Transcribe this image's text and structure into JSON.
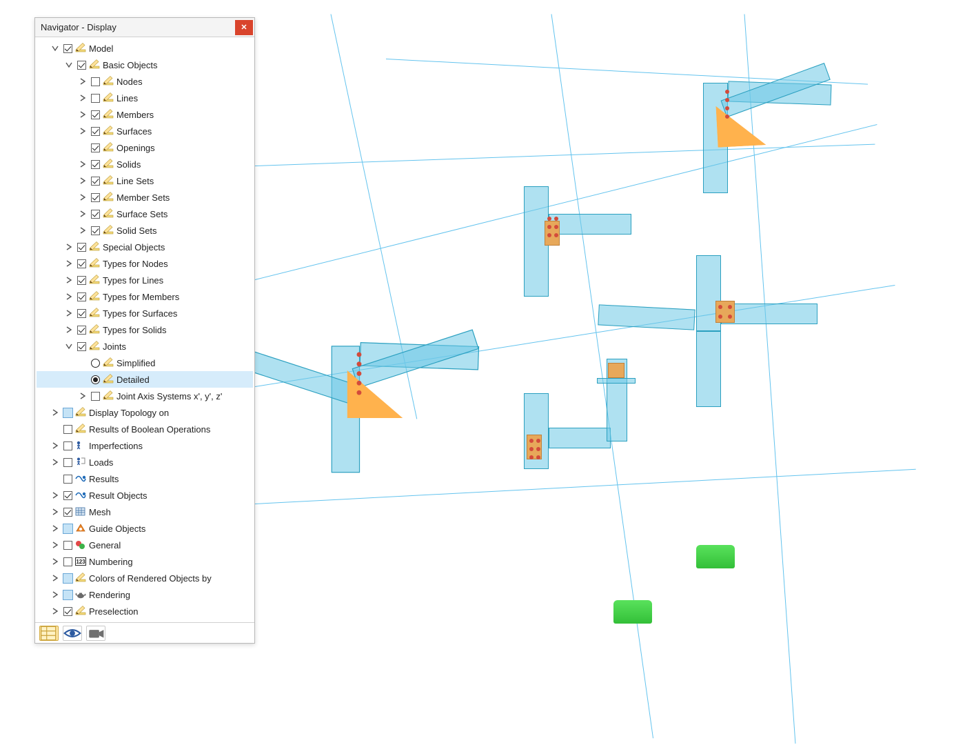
{
  "panel": {
    "title": "Navigator - Display",
    "tree": [
      {
        "indent": 0,
        "expander": "down",
        "check": "square-on",
        "icon": "pencil",
        "label": "Model"
      },
      {
        "indent": 1,
        "expander": "down",
        "check": "square-on",
        "icon": "pencil",
        "label": "Basic Objects"
      },
      {
        "indent": 2,
        "expander": "right",
        "check": "square-off",
        "icon": "pencil",
        "label": "Nodes"
      },
      {
        "indent": 2,
        "expander": "right",
        "check": "square-off",
        "icon": "pencil",
        "label": "Lines"
      },
      {
        "indent": 2,
        "expander": "right",
        "check": "square-on",
        "icon": "pencil",
        "label": "Members"
      },
      {
        "indent": 2,
        "expander": "right",
        "check": "square-on",
        "icon": "pencil",
        "label": "Surfaces"
      },
      {
        "indent": 2,
        "expander": "none",
        "check": "square-on",
        "icon": "pencil",
        "label": "Openings"
      },
      {
        "indent": 2,
        "expander": "right",
        "check": "square-on",
        "icon": "pencil",
        "label": "Solids"
      },
      {
        "indent": 2,
        "expander": "right",
        "check": "square-on",
        "icon": "pencil",
        "label": "Line Sets"
      },
      {
        "indent": 2,
        "expander": "right",
        "check": "square-on",
        "icon": "pencil",
        "label": "Member Sets"
      },
      {
        "indent": 2,
        "expander": "right",
        "check": "square-on",
        "icon": "pencil",
        "label": "Surface Sets"
      },
      {
        "indent": 2,
        "expander": "right",
        "check": "square-on",
        "icon": "pencil",
        "label": "Solid Sets"
      },
      {
        "indent": 1,
        "expander": "right",
        "check": "square-on",
        "icon": "pencil",
        "label": "Special Objects"
      },
      {
        "indent": 1,
        "expander": "right",
        "check": "square-on",
        "icon": "pencil",
        "label": "Types for Nodes"
      },
      {
        "indent": 1,
        "expander": "right",
        "check": "square-on",
        "icon": "pencil",
        "label": "Types for Lines"
      },
      {
        "indent": 1,
        "expander": "right",
        "check": "square-on",
        "icon": "pencil",
        "label": "Types for Members"
      },
      {
        "indent": 1,
        "expander": "right",
        "check": "square-on",
        "icon": "pencil",
        "label": "Types for Surfaces"
      },
      {
        "indent": 1,
        "expander": "right",
        "check": "square-on",
        "icon": "pencil",
        "label": "Types for Solids"
      },
      {
        "indent": 1,
        "expander": "down",
        "check": "square-on",
        "icon": "pencil",
        "label": "Joints"
      },
      {
        "indent": 2,
        "expander": "none",
        "check": "radio-off",
        "icon": "pencil",
        "label": "Simplified"
      },
      {
        "indent": 2,
        "expander": "none",
        "check": "radio-on",
        "icon": "pencil",
        "label": "Detailed",
        "selected": true
      },
      {
        "indent": 2,
        "expander": "right",
        "check": "square-off",
        "icon": "pencil",
        "label": "Joint Axis Systems x', y', z'"
      },
      {
        "indent": 0,
        "expander": "right",
        "check": "swatch",
        "icon": "pencil",
        "label": "Display Topology on"
      },
      {
        "indent": 0,
        "expander": "none",
        "check": "square-off",
        "icon": "pencil",
        "label": "Results of Boolean Operations"
      },
      {
        "indent": 0,
        "expander": "right",
        "check": "square-off",
        "icon": "imperf",
        "label": "Imperfections"
      },
      {
        "indent": 0,
        "expander": "right",
        "check": "square-off",
        "icon": "loads",
        "label": "Loads"
      },
      {
        "indent": 0,
        "expander": "none",
        "check": "square-off",
        "icon": "results",
        "label": "Results"
      },
      {
        "indent": 0,
        "expander": "right",
        "check": "square-on",
        "icon": "results",
        "label": "Result Objects"
      },
      {
        "indent": 0,
        "expander": "right",
        "check": "square-on",
        "icon": "mesh",
        "label": "Mesh"
      },
      {
        "indent": 0,
        "expander": "right",
        "check": "swatch",
        "icon": "guide",
        "label": "Guide Objects"
      },
      {
        "indent": 0,
        "expander": "right",
        "check": "square-off",
        "icon": "general",
        "label": "General"
      },
      {
        "indent": 0,
        "expander": "right",
        "check": "square-off",
        "icon": "number",
        "label": "Numbering"
      },
      {
        "indent": 0,
        "expander": "right",
        "check": "swatch",
        "icon": "pencil",
        "label": "Colors of Rendered Objects by"
      },
      {
        "indent": 0,
        "expander": "right",
        "check": "swatch",
        "icon": "teapot",
        "label": "Rendering"
      },
      {
        "indent": 0,
        "expander": "right",
        "check": "square-on",
        "icon": "pencil",
        "label": "Preselection"
      }
    ],
    "footer_buttons": {
      "data_mode": "data",
      "eye_mode": "eye",
      "camera_mode": "camera"
    }
  },
  "colors": {
    "steel": "#6ecce6",
    "steel_edge": "#2a9fbf",
    "gusset": "#ffb24d",
    "bolt": "#d34b3b",
    "support": "#33bf38",
    "wire": "#63c3ee"
  }
}
